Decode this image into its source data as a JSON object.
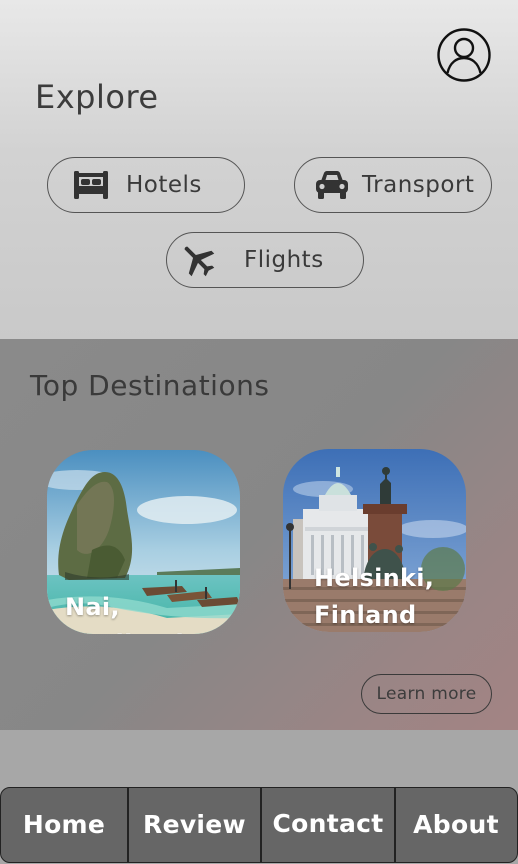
{
  "header": {
    "title": "Explore",
    "profile_icon": "user-circle-icon"
  },
  "categories": [
    {
      "label": "Hotels",
      "icon": "bed-icon"
    },
    {
      "label": "Transport",
      "icon": "car-icon"
    },
    {
      "label": "Flights",
      "icon": "airplane-icon"
    }
  ],
  "destinations": {
    "title": "Top Destinations",
    "items": [
      {
        "line1": "Nai, Thailand",
        "line2": ""
      },
      {
        "line1": "Helsinki,",
        "line2": "Finland"
      }
    ],
    "learn_more": "Learn more"
  },
  "nav": {
    "items": [
      "Home",
      "Review",
      "Contact",
      "About"
    ]
  },
  "colors": {
    "top_background": "#dcdcdc",
    "mid_background": "#898989",
    "nav_background": "#666666",
    "text_dark": "#3a3a3a"
  }
}
